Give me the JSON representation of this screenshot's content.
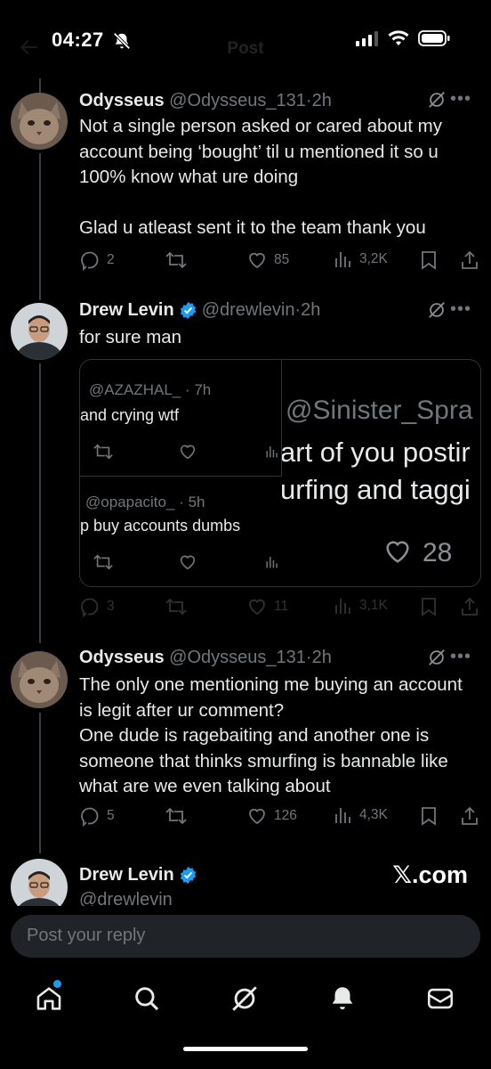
{
  "status": {
    "time": "04:27"
  },
  "header": {
    "title": "Post"
  },
  "posts": [
    {
      "name": "Odysseus",
      "handle": "@Odysseus_131",
      "time": "2h",
      "text": "Not a single person asked or cared about my account being ‘bought’ til u mentioned it so u 100% know what ure doing\n\nGlad u atleast sent it to the team thank you",
      "replies": "2",
      "likes": "85",
      "views": "3,2K"
    },
    {
      "name": "Drew Levin",
      "handle": "@drewlevin",
      "time": "2h",
      "text": "for sure man",
      "replies": "3",
      "likes": "11",
      "views": "3,1K",
      "verified": true
    },
    {
      "name": "Odysseus",
      "handle": "@Odysseus_131",
      "time": "2h",
      "text": "The only one mentioning me buying an account is legit after ur comment?\nOne dude is ragebaiting and another one is someone that thinks smurfing is bannable like what are we even talking about",
      "replies": "5",
      "likes": "126",
      "views": "4,3K"
    }
  ],
  "quote": {
    "item1_handle": "@AZAZHAL_",
    "item1_time": "7h",
    "item1_text": "and crying wtf",
    "item2_handle": "@opapacito_",
    "item2_time": "5h",
    "item2_text": "p buy accounts dumbs",
    "big_handle": "@Sinister_Spra",
    "big_line1": "art of you postir",
    "big_line2": "urfing and taggi",
    "big_likes": "28"
  },
  "next_post": {
    "name": "Drew Levin",
    "handle": "@drewlevin"
  },
  "watermark": "𝕏.com",
  "reply": {
    "placeholder": "Post your reply"
  },
  "colors": {
    "background": "#000000",
    "text": "#e7e9ea",
    "muted": "#71767b",
    "verified": "#1d9bf0",
    "notification_dot": "#1d9bf0"
  }
}
